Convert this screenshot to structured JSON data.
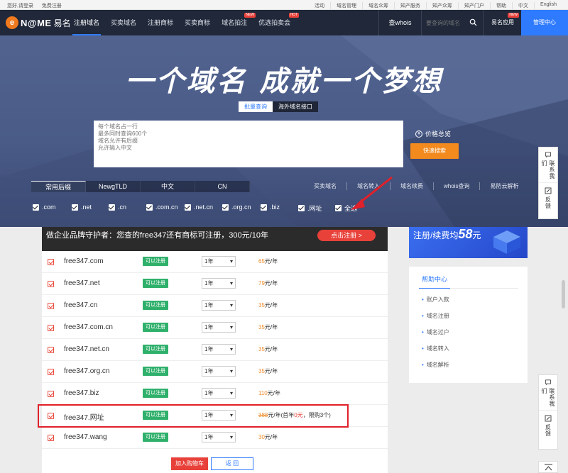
{
  "topbar": {
    "login": "您好,请登录",
    "register": "免费注册",
    "links": [
      "活动",
      "域名管理",
      "域名众筹",
      "知产服务",
      "知产众筹",
      "知产门户",
      "帮助",
      "中文",
      "English"
    ]
  },
  "nav": {
    "logo_text": "N@ME",
    "logo_cn": "易名",
    "menu": [
      {
        "label": "注册域名",
        "badge": ""
      },
      {
        "label": "买卖域名",
        "badge": ""
      },
      {
        "label": "注册商标",
        "badge": ""
      },
      {
        "label": "买卖商标",
        "badge": ""
      },
      {
        "label": "域名拍注",
        "badge": "NEW"
      },
      {
        "label": "优选拍卖会",
        "badge": "HOT"
      }
    ],
    "whois": "查whois",
    "search_placeholder": "要查询的域名",
    "app": "易名应用",
    "app_badge": "NEW",
    "manage": "管理中心"
  },
  "hero": {
    "slogan": "一个域名 成就一个梦想",
    "tabs": [
      "批量查询",
      "海外域名接口"
    ],
    "query_placeholder": "每个域名占一行\n最多同时查询600个\n域名允许有后缀\n允许输入中文",
    "price_link": "价格总览",
    "query_btn": "快速搜索",
    "suffix_tabs": [
      "常用后缀",
      "NewgTLD",
      "中文",
      "CN"
    ],
    "quick_links": [
      "买卖域名",
      "域名转入",
      "域名续费",
      "whois查询",
      "易防云解析"
    ],
    "checks": [
      ".com",
      ".net",
      ".cn",
      ".com.cn",
      ".net.cn",
      ".org.cn",
      ".biz",
      ".网址",
      "全选"
    ]
  },
  "promo": {
    "text": "做企业品牌守护者：您查的free347还有商标可注册，300元/10年",
    "btn": "点击注册 >"
  },
  "results": [
    {
      "domain": "free347.com",
      "status": "可以注册",
      "years": "1年",
      "price": "65",
      "unit": "元/年"
    },
    {
      "domain": "free347.net",
      "status": "可以注册",
      "years": "1年",
      "price": "79",
      "unit": "元/年"
    },
    {
      "domain": "free347.cn",
      "status": "可以注册",
      "years": "1年",
      "price": "35",
      "unit": "元/年"
    },
    {
      "domain": "free347.com.cn",
      "status": "可以注册",
      "years": "1年",
      "price": "35",
      "unit": "元/年"
    },
    {
      "domain": "free347.net.cn",
      "status": "可以注册",
      "years": "1年",
      "price": "35",
      "unit": "元/年"
    },
    {
      "domain": "free347.org.cn",
      "status": "可以注册",
      "years": "1年",
      "price": "35",
      "unit": "元/年"
    },
    {
      "domain": "free347.biz",
      "status": "可以注册",
      "years": "1年",
      "price": "110",
      "unit": "元/年"
    },
    {
      "domain": "free347.网址",
      "status": "可以注册",
      "years": "1年",
      "price": "388",
      "unit": "元/年",
      "promo_prefix": "(首年",
      "promo_price": "0元",
      "promo_suffix": "，限购3个)"
    },
    {
      "domain": "free347.wang",
      "status": "可以注册",
      "years": "1年",
      "price": "30",
      "unit": "元/年"
    }
  ],
  "actions": {
    "cart": "加入购物车",
    "back": "返 回"
  },
  "banner": {
    "prefix": "注册/续费均",
    "price": "58",
    "unit": "元"
  },
  "help": {
    "title": "帮助中心",
    "items": [
      "账户入款",
      "域名注册",
      "域名过户",
      "域名转入",
      "域名解析"
    ]
  },
  "side": {
    "contact": "联系我们",
    "feedback": "反馈"
  },
  "colors": {
    "nav_bg": "#20283a",
    "accent": "#2f7bff",
    "orange": "#f28a1e",
    "green": "#2fb06b",
    "red": "#e8413a"
  }
}
